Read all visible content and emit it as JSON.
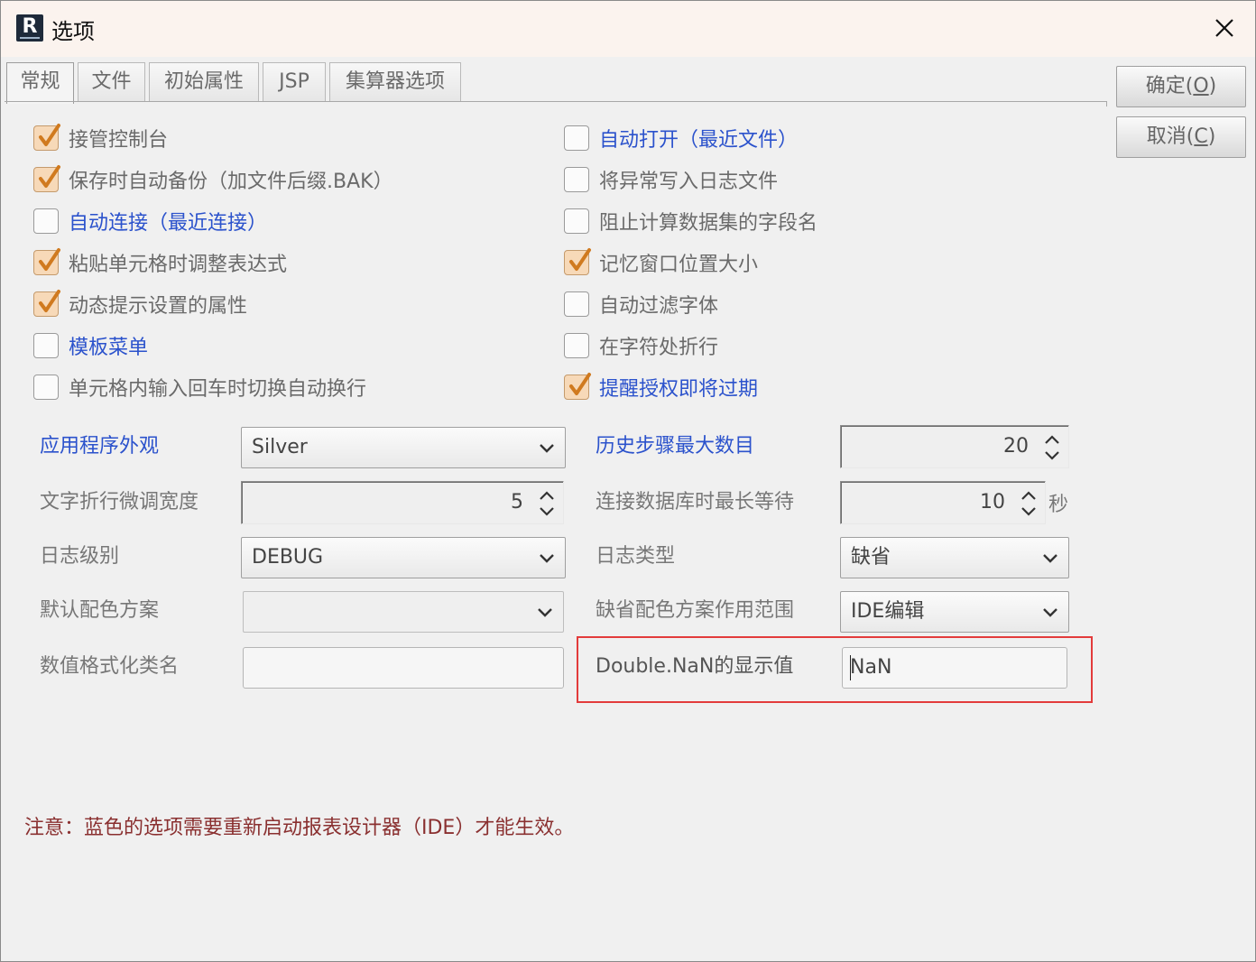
{
  "window": {
    "title": "选项",
    "icon": "report-app-icon"
  },
  "tabs": [
    {
      "label": "常规",
      "active": true
    },
    {
      "label": "文件",
      "active": false
    },
    {
      "label": "初始属性",
      "active": false
    },
    {
      "label": "JSP",
      "active": false
    },
    {
      "label": "集算器选项",
      "active": false
    }
  ],
  "buttons": {
    "ok_label": "确定(",
    "ok_key": "O",
    "ok_tail": ")",
    "cancel_label": "取消(",
    "cancel_key": "C",
    "cancel_tail": ")"
  },
  "left_checks": [
    {
      "label": "接管控制台",
      "checked": true,
      "blue": false
    },
    {
      "label": "保存时自动备份（加文件后缀.BAK）",
      "checked": true,
      "blue": false
    },
    {
      "label": "自动连接（最近连接）",
      "checked": false,
      "blue": true
    },
    {
      "label": "粘贴单元格时调整表达式",
      "checked": true,
      "blue": false
    },
    {
      "label": "动态提示设置的属性",
      "checked": true,
      "blue": false
    },
    {
      "label": "模板菜单",
      "checked": false,
      "blue": true
    },
    {
      "label": "单元格内输入回车时切换自动换行",
      "checked": false,
      "blue": false
    }
  ],
  "right_checks": [
    {
      "label": "自动打开（最近文件）",
      "checked": false,
      "blue": true
    },
    {
      "label": "将异常写入日志文件",
      "checked": false,
      "blue": false
    },
    {
      "label": "阻止计算数据集的字段名",
      "checked": false,
      "blue": false
    },
    {
      "label": "记忆窗口位置大小",
      "checked": true,
      "blue": false
    },
    {
      "label": "自动过滤字体",
      "checked": false,
      "blue": false
    },
    {
      "label": "在字符处折行",
      "checked": false,
      "blue": false
    },
    {
      "label": "提醒授权即将过期",
      "checked": true,
      "blue": true
    }
  ],
  "fields": {
    "appearance_label": "应用程序外观",
    "appearance_value": "Silver",
    "wrap_width_label": "文字折行微调宽度",
    "wrap_width_value": "5",
    "log_level_label": "日志级别",
    "log_level_value": "DEBUG",
    "color_scheme_label": "默认配色方案",
    "color_scheme_value": "",
    "number_format_label": "数值格式化类名",
    "number_format_value": "",
    "max_steps_label": "历史步骤最大数目",
    "max_steps_value": "20",
    "db_wait_label": "连接数据库时最长等待",
    "db_wait_value": "10",
    "db_wait_unit": "秒",
    "log_type_label": "日志类型",
    "log_type_value": "缺省",
    "scheme_scope_label": "缺省配色方案作用范围",
    "scheme_scope_value": "IDE编辑",
    "nan_label": "Double.NaN的显示值",
    "nan_value": "NaN"
  },
  "note": "注意：蓝色的选项需要重新启动报表设计器（IDE）才能生效。",
  "colors": {
    "blue_option": "#2b52cc",
    "note": "#8a3030",
    "highlight": "#e33b3b",
    "check_fill": "#f7d9b8",
    "check_mark": "#d07a1f"
  }
}
